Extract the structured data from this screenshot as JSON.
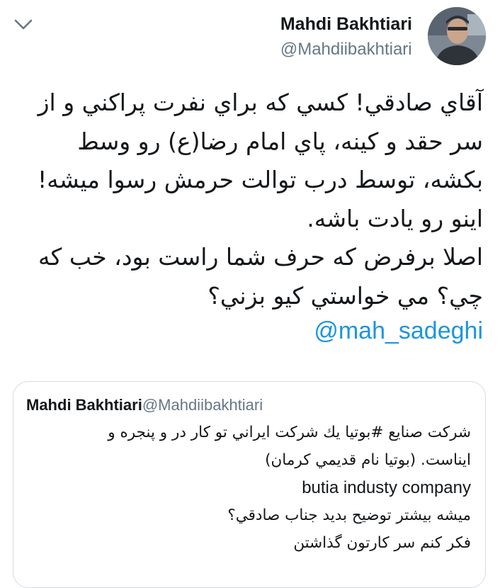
{
  "header": {
    "author_name": "Mahdi Bakhtiari",
    "author_handle": "@Mahdiibakhtiari",
    "menu_icon": "chevron-down-icon",
    "avatar_icon": "avatar"
  },
  "tweet": {
    "lines": [
      "آقاي صادقي! كسي كه براي نفرت پراكني و از",
      "سر حقد و كينه، پاي امام رضا(ع) رو وسط",
      "بكشه، توسط درب توالت حرمش رسوا ميشه!",
      "اينو رو يادت باشه.",
      "اصلا برفرض كه حرف شما راست بود، خب كه",
      "چي؟ مي خواستي كيو بزني؟"
    ],
    "mention": "@mah_sadeghi"
  },
  "quoted_tweet": {
    "author_name": "Mahdi Bakhtiari",
    "author_handle": "@Mahdiibakhtiari",
    "lines": [
      "شركت صنايع #بوتيا يك شركت ايراني تو كار در و پنجره و",
      "ايناست. (بوتيا نام قديمي كرمان)",
      "butia industy company",
      "ميشه بيشتر توضيح بديد جناب صادقي؟",
      "فكر كنم سر كارتون گذاشتن"
    ]
  },
  "colors": {
    "text": "#14171a",
    "secondary": "#657786",
    "link": "#1b95e0",
    "border": "#d4dde4"
  }
}
